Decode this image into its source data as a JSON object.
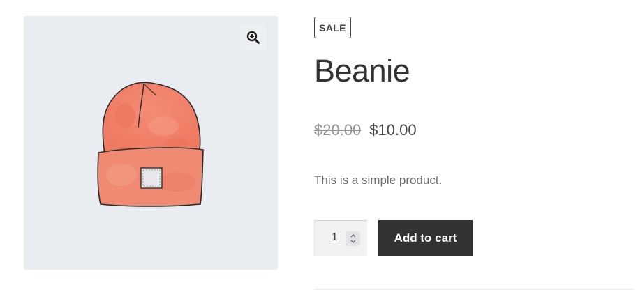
{
  "product": {
    "sale_badge": "SALE",
    "title": "Beanie",
    "regular_price": "$20.00",
    "sale_price": "$10.00",
    "description": "This is a simple product.",
    "quantity": "1",
    "add_to_cart_label": "Add to cart"
  },
  "gallery": {
    "zoom_icon": "zoom-in-icon",
    "image_subject": "beanie-image",
    "background_color": "#e9edf1",
    "beanie_color": "#f08a72"
  },
  "colors": {
    "button_bg": "#333333",
    "text_dark": "#43454b",
    "strike_price": "#8f9197"
  }
}
